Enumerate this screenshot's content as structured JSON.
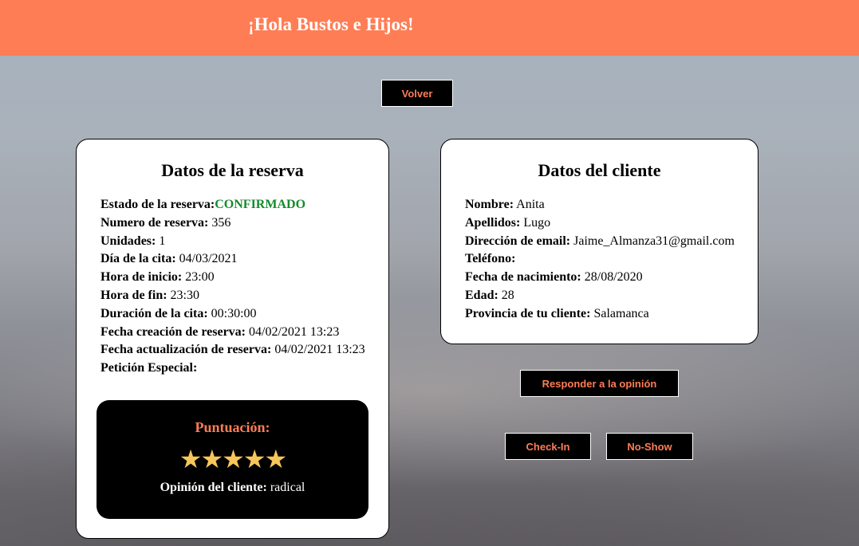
{
  "header": {
    "title": "¡Hola Bustos e Hijos!",
    "bg_color": "#ff7d55"
  },
  "buttons": {
    "volver": "Volver",
    "responder": "Responder a la opinión",
    "checkin": "Check-In",
    "noshow": "No-Show"
  },
  "reserva": {
    "title": "Datos de la reserva",
    "estado_label": "Estado de la reserva:",
    "estado_value": "CONFIRMADO",
    "numero_label": "Numero de reserva:",
    "numero_value": "356",
    "unidades_label": "Unidades:",
    "unidades_value": "1",
    "dia_label": "Día de la cita:",
    "dia_value": "04/03/2021",
    "inicio_label": "Hora de inicio:",
    "inicio_value": "23:00",
    "fin_label": "Hora de fin:",
    "fin_value": "23:30",
    "duracion_label": "Duración de la cita:",
    "duracion_value": "00:30:00",
    "creacion_label": "Fecha creación de reserva:",
    "creacion_value": "04/02/2021 13:23",
    "actualizacion_label": "Fecha actualización de reserva:",
    "actualizacion_value": "04/02/2021 13:23",
    "peticion_label": "Petición Especial:",
    "peticion_value": ""
  },
  "puntuacion": {
    "title": "Puntuación:",
    "rating": 5,
    "max_rating": 5,
    "stars_text": "★★★★★",
    "opinion_label": "Opinión del cliente:",
    "opinion_value": "radical"
  },
  "cliente": {
    "title": "Datos del cliente",
    "nombre_label": "Nombre:",
    "nombre_value": "Anita",
    "apellidos_label": "Apellidos:",
    "apellidos_value": "Lugo",
    "email_label": "Dirección de email:",
    "email_value": "Jaime_Almanza31@gmail.com",
    "telefono_label": "Teléfono:",
    "telefono_value": "",
    "nacimiento_label": "Fecha de nacimiento:",
    "nacimiento_value": "28/08/2020",
    "edad_label": "Edad:",
    "edad_value": "28",
    "provincia_label": "Provincia de tu cliente:",
    "provincia_value": "Salamanca"
  },
  "colors": {
    "accent": "#ff7d55",
    "status_confirmed": "#148c2c",
    "star": "#f6c65b"
  }
}
